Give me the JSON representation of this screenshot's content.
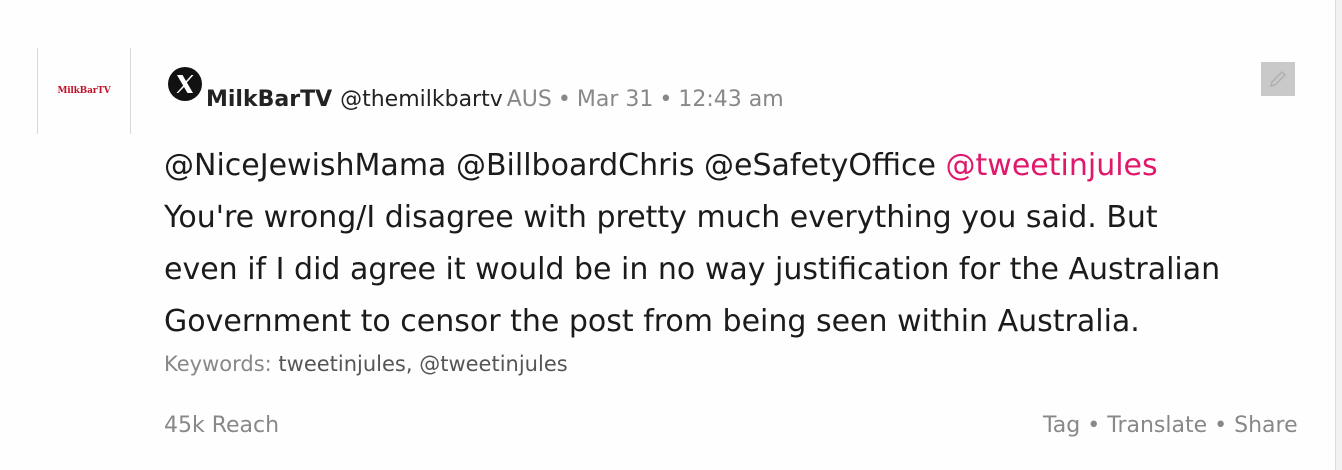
{
  "post": {
    "avatar_text": "MilkBarTV",
    "author_name": "MilkBarTV",
    "handle": "@themilkbartv",
    "country": "AUS",
    "separator": "•",
    "date": "Mar 31",
    "time": "12:43 am",
    "mentions": [
      "@NiceJewishMama",
      "@BillboardChris",
      "@eSafetyOffice"
    ],
    "highlighted_mention": "@tweetinjules",
    "text_lines": [
      "You're wrong/I disagree with pretty much everything you said. But",
      "even if I did agree it would be in no way justification for the Australian",
      "Government to censor the post from being seen within Australia."
    ],
    "keywords_label": "Keywords:",
    "keywords_value": "tweetinjules, @tweetinjules",
    "reach": "45k Reach",
    "actions": [
      "Tag",
      "Translate",
      "Share"
    ]
  },
  "colors": {
    "highlight": "#e0186c",
    "avatar_text": "#c0142a",
    "muted": "#888888"
  },
  "icons": {
    "platform": "x-logo-icon",
    "edit": "edit-pencil-icon"
  }
}
